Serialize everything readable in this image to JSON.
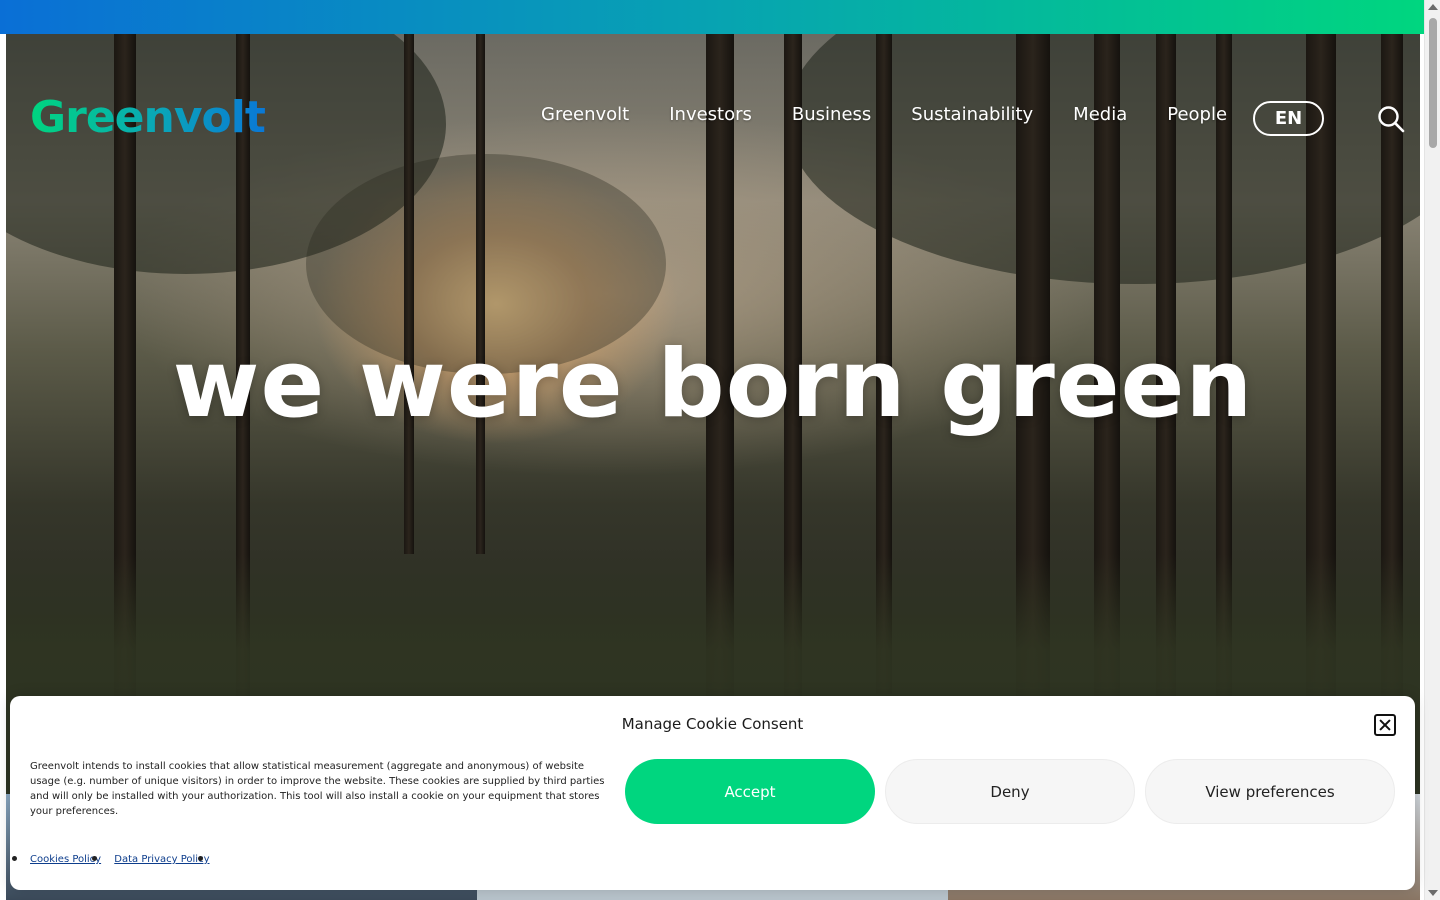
{
  "header": {
    "logo_text": "Greenvolt",
    "nav": [
      "Greenvolt",
      "Investors",
      "Business",
      "Sustainability",
      "Media",
      "People"
    ],
    "language": "EN",
    "search_icon": "search-icon"
  },
  "hero": {
    "title": "we were born green"
  },
  "cookie_banner": {
    "title": "Manage Cookie Consent",
    "text": "Greenvolt intends to install cookies that allow statistical measurement (aggregate and anonymous) of website usage (e.g. number of unique visitors) in order to improve the website. These cookies are supplied by third parties and will only be installed with your authorization. This tool will also install a cookie on your equipment that stores your preferences.",
    "accept_label": "Accept",
    "deny_label": "Deny",
    "preferences_label": "View preferences",
    "links": [
      "Cookies Policy",
      "Data Privacy Policy"
    ],
    "close_icon": "close-icon"
  },
  "colors": {
    "brand_green": "#00d67f",
    "brand_blue": "#0a78d6",
    "link": "#0d3d8c"
  }
}
